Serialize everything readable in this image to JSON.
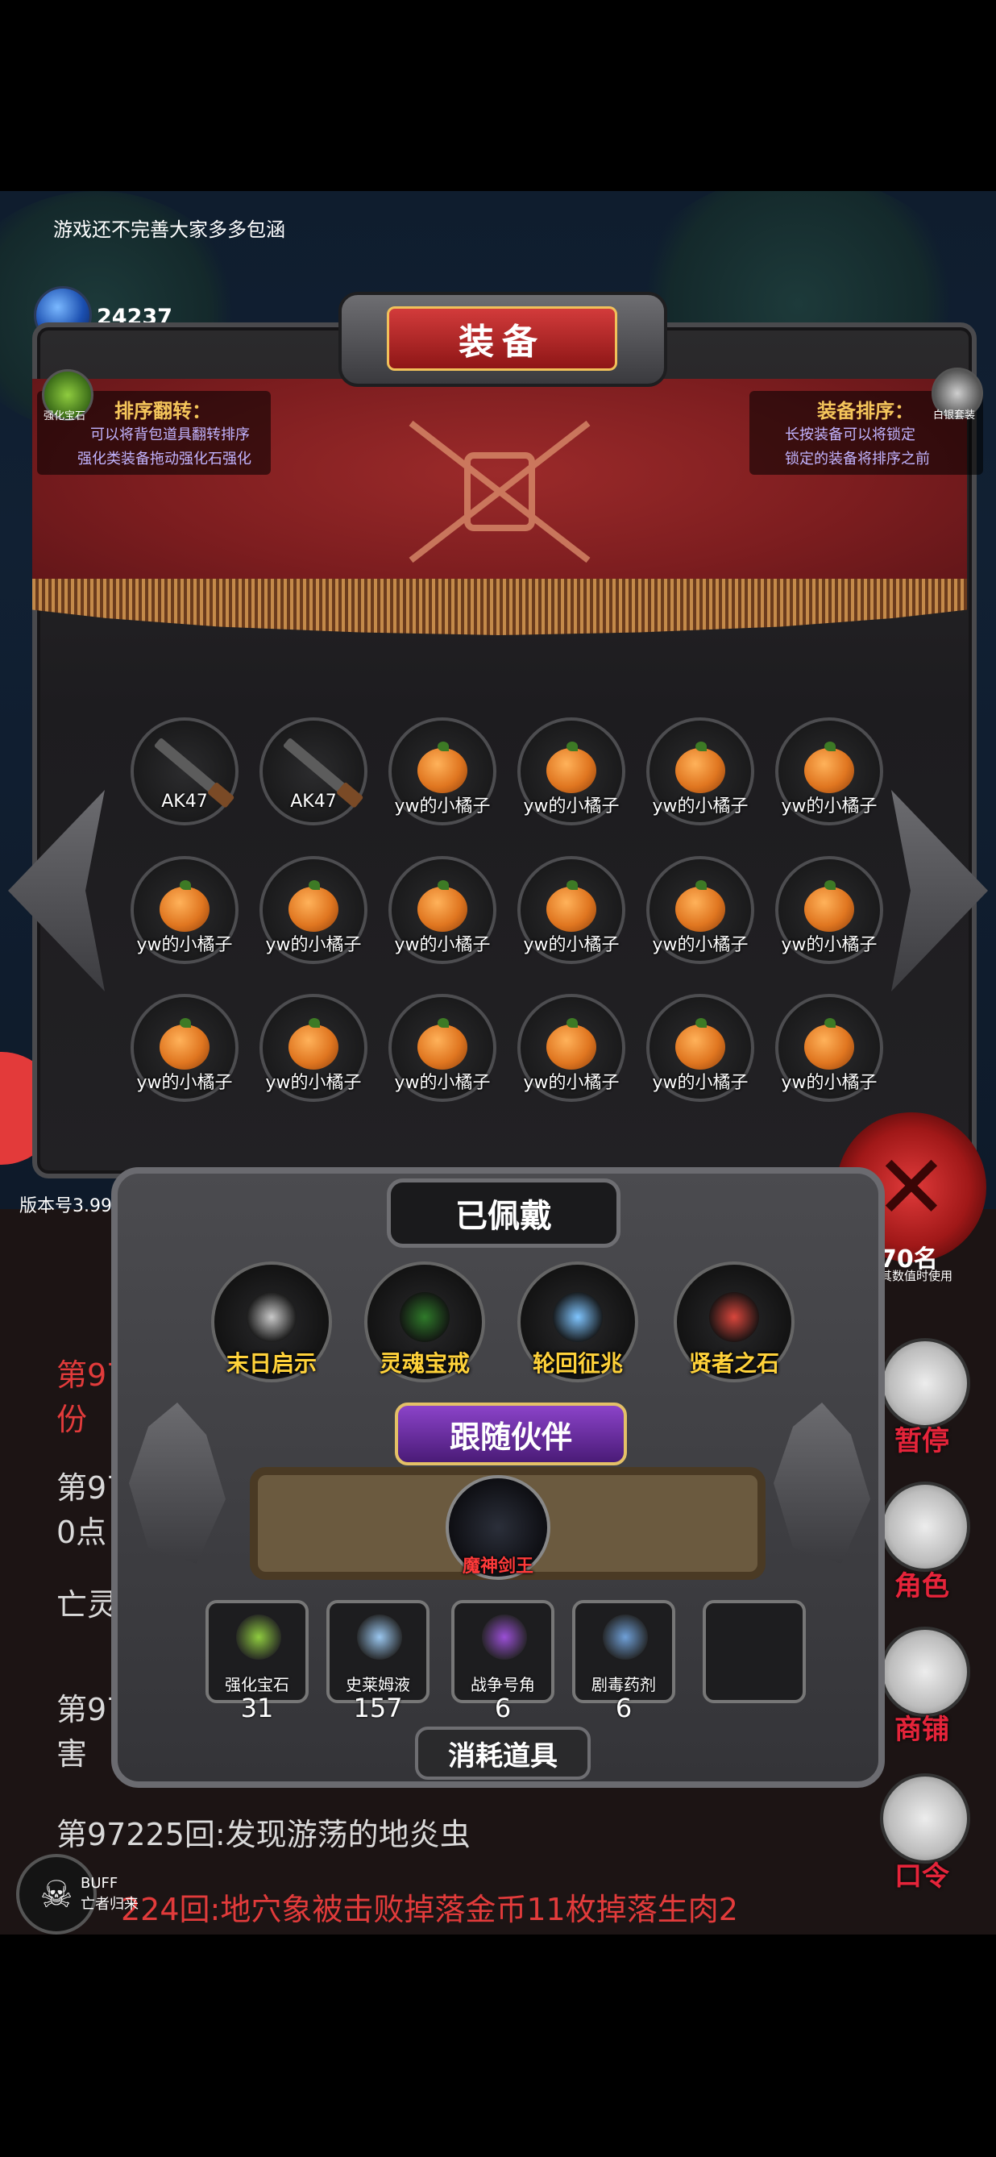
{
  "notice": "游戏还不完善大家多多包涵",
  "gem": {
    "label": "宝石",
    "count": "24237"
  },
  "panel_title": "装备",
  "hint_left": {
    "title": "排序翻转：",
    "line1": "可以将背包道具翻转排序",
    "line2": "强化类装备拖动强化石强化"
  },
  "hint_right": {
    "title": "装备排序：",
    "line1": "长按装备可以将锁定",
    "line2": "锁定的装备将排序之前"
  },
  "side_left_label": "强化宝石",
  "side_right_label": "白银套装",
  "inventory": [
    {
      "name": "AK47",
      "icon": "rifle-icon"
    },
    {
      "name": "AK47",
      "icon": "rifle-icon"
    },
    {
      "name": "yw的小橘子",
      "icon": "orange-icon"
    },
    {
      "name": "yw的小橘子",
      "icon": "orange-icon"
    },
    {
      "name": "yw的小橘子",
      "icon": "orange-icon"
    },
    {
      "name": "yw的小橘子",
      "icon": "orange-icon"
    },
    {
      "name": "yw的小橘子",
      "icon": "orange-icon"
    },
    {
      "name": "yw的小橘子",
      "icon": "orange-icon"
    },
    {
      "name": "yw的小橘子",
      "icon": "orange-icon"
    },
    {
      "name": "yw的小橘子",
      "icon": "orange-icon"
    },
    {
      "name": "yw的小橘子",
      "icon": "orange-icon"
    },
    {
      "name": "yw的小橘子",
      "icon": "orange-icon"
    },
    {
      "name": "yw的小橘子",
      "icon": "orange-icon"
    },
    {
      "name": "yw的小橘子",
      "icon": "orange-icon"
    },
    {
      "name": "yw的小橘子",
      "icon": "orange-icon"
    },
    {
      "name": "yw的小橘子",
      "icon": "orange-icon"
    },
    {
      "name": "yw的小橘子",
      "icon": "orange-icon"
    },
    {
      "name": "yw的小橘子",
      "icon": "orange-icon"
    }
  ],
  "equipped_title": "已佩戴",
  "equipped": [
    {
      "name": "末日启示",
      "icon": "crossbow-icon"
    },
    {
      "name": "灵魂宝戒",
      "icon": "ring-icon"
    },
    {
      "name": "轮回征兆",
      "icon": "staff-icon"
    },
    {
      "name": "贤者之石",
      "icon": "stone-icon"
    }
  ],
  "companion_title": "跟随伙伴",
  "companion_name": "魔神剑王",
  "consumables_title": "消耗道具",
  "consumables": [
    {
      "name": "强化宝石",
      "count": "31",
      "icon": "gem-icon"
    },
    {
      "name": "史莱姆液",
      "count": "157",
      "icon": "potion-icon"
    },
    {
      "name": "战争号角",
      "count": "6",
      "icon": "horn-icon"
    },
    {
      "name": "剧毒药剂",
      "count": "6",
      "icon": "poison-icon"
    }
  ],
  "version": "版本号3.99",
  "log": {
    "line1a": "第97",
    "line1b": "份",
    "line2a": "第97",
    "line2b": "0点",
    "line3": "亡灵",
    "line4a": "第97",
    "line4b": "害",
    "line5": "第97225回:发现游荡的地炎虫",
    "line6": "224回:地穴象被击败掉落金币11枚掉落生肉2"
  },
  "right_buttons": [
    "暂停",
    "角色",
    "商铺",
    "口令"
  ],
  "counter": {
    "value": "70名",
    "sub": "其数值时使用"
  },
  "buff": {
    "label": "BUFF",
    "sub": "亡者归来"
  },
  "colors": {
    "accent_red": "#e5243a",
    "banner_red": "#8e1c1f",
    "gold": "#ffd23a"
  }
}
